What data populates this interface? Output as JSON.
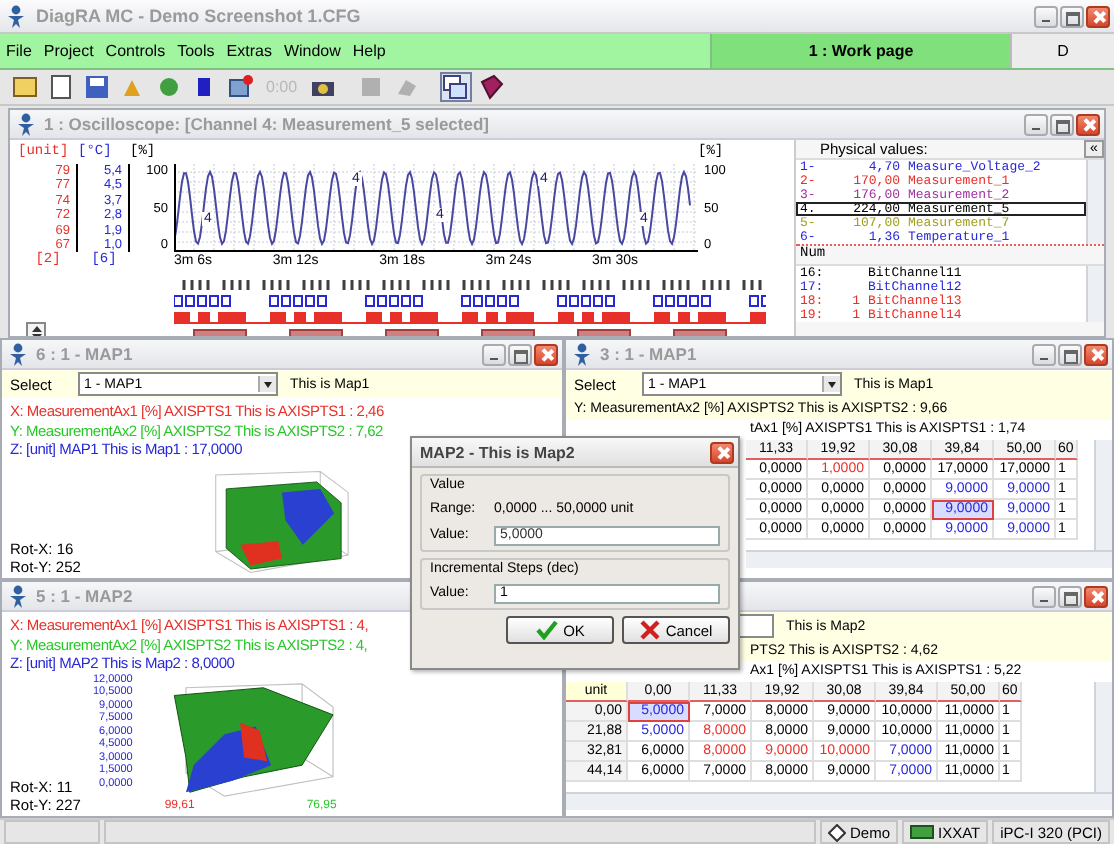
{
  "window": {
    "title": "DiagRA MC - Demo Screenshot 1.CFG"
  },
  "menu": [
    "File",
    "Project",
    "Controls",
    "Tools",
    "Extras",
    "Window",
    "Help"
  ],
  "work_page": {
    "label": "1 : Work page",
    "selected": true
  },
  "work_page_button": "D",
  "toolbar": {
    "timer": "0:00"
  },
  "oscilloscope": {
    "title": "1 : Oscilloscope: [Channel 4: Measurement_5 selected]",
    "axes": [
      {
        "header": "[unit]",
        "ticks": [
          "79",
          "77",
          "74",
          "72",
          "69",
          "67"
        ],
        "footer": "[2]",
        "color": "#e8302a"
      },
      {
        "header": "[°C]",
        "ticks": [
          "5,4",
          "4,5",
          "3,7",
          "2,8",
          "1,9",
          "1,0"
        ],
        "footer": "[6]",
        "color": "#2828d8"
      }
    ],
    "left_percent_axis": {
      "header": "[%]",
      "ticks": [
        "100",
        "50",
        "0"
      ]
    },
    "right_percent_axis": {
      "header": "[%]",
      "ticks": [
        "100",
        "50",
        "0"
      ]
    },
    "time_ticks": [
      "3m 6s",
      "3m 12s",
      "3m 18s",
      "3m 24s",
      "3m 30s"
    ],
    "markers": [
      "4",
      "4",
      "4",
      "4",
      "4"
    ],
    "physical_values": {
      "title": "Physical values:",
      "collapse": "«",
      "rows": [
        {
          "num": "1-",
          "value": "4,70",
          "name": "Measure_Voltage_2",
          "color": "#2828d8",
          "selected": false
        },
        {
          "num": "2-",
          "value": "170,00",
          "name": "Measurement_1",
          "color": "#e8302a",
          "selected": false
        },
        {
          "num": "3-",
          "value": "176,00",
          "name": "Measurement_2",
          "color": "#a030a0",
          "selected": false
        },
        {
          "num": "4.",
          "value": "224,00",
          "name": "Measurement_5",
          "color": "#000000",
          "selected": true
        },
        {
          "num": "5-",
          "value": "107,00",
          "name": "Measurement_7",
          "color": "#a0a020",
          "selected": false
        },
        {
          "num": "6-",
          "value": "1,36",
          "name": "Temperature_1",
          "color": "#2828d8",
          "selected": false
        }
      ]
    },
    "bit_channels": {
      "header": "Num",
      "rows": [
        {
          "num": "16:",
          "name": "BitChannel11",
          "color": "#000000"
        },
        {
          "num": "17:",
          "name": "BitChannel12",
          "color": "#2828d8"
        },
        {
          "num": "18:",
          "value": "1",
          "name": "BitChannel13",
          "color": "#e8302a"
        },
        {
          "num": "19:",
          "value": "1",
          "name": "BitChannel14",
          "color": "#e8302a"
        }
      ]
    }
  },
  "map1_plot": {
    "title": "6 : 1 - MAP1",
    "select_label": "Select",
    "select_value": "1 - MAP1",
    "description": "This is Map1",
    "axis_lines": [
      {
        "text": "X: MeasurementAx1 [%] AXISPTS1 This is AXISPTS1 : 2,46",
        "color": "#e8302a"
      },
      {
        "text": "Y: MeasurementAx2 [%] AXISPTS2 This is AXISPTS2 : 7,62",
        "color": "#28c828"
      },
      {
        "text": "Z: [unit] MAP1 This is Map1 : 17,0000",
        "color": "#2828d8"
      }
    ],
    "rot_x": "Rot-X: 16",
    "rot_y": "Rot-Y: 252"
  },
  "map1_table": {
    "title": "3 : 1 - MAP1",
    "select_label": "Select",
    "select_value": "1 - MAP1",
    "description": "This is Map1",
    "y_line": "Y: MeasurementAx2 [%] AXISPTS2 This is AXISPTS2 : 9,66",
    "x_line": "tAx1 [%] AXISPTS1 This is AXISPTS1 : 1,74",
    "columns": [
      "11,33",
      "19,92",
      "30,08",
      "39,84",
      "50,00",
      "60"
    ],
    "rows": [
      {
        "cells": [
          {
            "text": "0,0000",
            "color": "#000000",
            "selected": false
          },
          {
            "text": "1,0000",
            "color": "#e8302a",
            "selected": false
          },
          {
            "text": "0,0000",
            "color": "#000000",
            "selected": false
          },
          {
            "text": "17,0000",
            "color": "#000000",
            "selected": false
          },
          {
            "text": "17,0000",
            "color": "#000000",
            "selected": false
          },
          {
            "text": "1",
            "color": "#000000",
            "selected": false
          }
        ]
      },
      {
        "cells": [
          {
            "text": "0,0000",
            "color": "#000000",
            "selected": false
          },
          {
            "text": "0,0000",
            "color": "#000000",
            "selected": false
          },
          {
            "text": "0,0000",
            "color": "#000000",
            "selected": false
          },
          {
            "text": "9,0000",
            "color": "#2828d8",
            "selected": false
          },
          {
            "text": "9,0000",
            "color": "#2828d8",
            "selected": false
          },
          {
            "text": "1",
            "color": "#000000",
            "selected": false
          }
        ]
      },
      {
        "cells": [
          {
            "text": "0,0000",
            "color": "#000000",
            "selected": false
          },
          {
            "text": "0,0000",
            "color": "#000000",
            "selected": false
          },
          {
            "text": "0,0000",
            "color": "#000000",
            "selected": false
          },
          {
            "text": "9,0000",
            "color": "#2828d8",
            "selected": true
          },
          {
            "text": "9,0000",
            "color": "#2828d8",
            "selected": false
          },
          {
            "text": "1",
            "color": "#000000",
            "selected": false
          }
        ]
      },
      {
        "cells": [
          {
            "text": "0,0000",
            "color": "#000000",
            "selected": false
          },
          {
            "text": "0,0000",
            "color": "#000000",
            "selected": false
          },
          {
            "text": "0,0000",
            "color": "#000000",
            "selected": false
          },
          {
            "text": "9,0000",
            "color": "#2828d8",
            "selected": false
          },
          {
            "text": "9,0000",
            "color": "#2828d8",
            "selected": false
          },
          {
            "text": "1",
            "color": "#000000",
            "selected": false
          }
        ]
      }
    ]
  },
  "map2_plot": {
    "title": "5 : 1 - MAP2",
    "axis_lines": [
      {
        "text": "X: MeasurementAx1 [%] AXISPTS1 This is AXISPTS1 : 4,",
        "color": "#e8302a"
      },
      {
        "text": "Y: MeasurementAx2 [%] AXISPTS2 This is AXISPTS2 : 4,",
        "color": "#28c828"
      },
      {
        "text": "Z: [unit] MAP2 This is Map2 : 8,0000",
        "color": "#2828d8"
      }
    ],
    "z_ticks": [
      "12,0000",
      "10,5000",
      "9,0000",
      "7,5000",
      "6,0000",
      "4,5000",
      "3,0000",
      "1,5000",
      "0,0000"
    ],
    "x_tick": "99,61",
    "y_tick": "76,95",
    "rot_x": "Rot-X: 11",
    "rot_y": "Rot-Y: 227"
  },
  "map2_table": {
    "description": "This is Map2",
    "y_line": "PTS2 This is AXISPTS2 : 4,62",
    "x_line": "Ax1 [%] AXISPTS1 This is AXISPTS1 : 5,22",
    "corner": "unit",
    "columns": [
      "0,00",
      "11,33",
      "19,92",
      "30,08",
      "39,84",
      "50,00",
      "60"
    ],
    "rows": [
      {
        "header": "0,00",
        "cells": [
          {
            "text": "5,0000",
            "color": "#2828d8",
            "selected": true
          },
          {
            "text": "7,0000",
            "color": "#000000",
            "selected": false
          },
          {
            "text": "8,0000",
            "color": "#000000",
            "selected": false
          },
          {
            "text": "9,0000",
            "color": "#000000",
            "selected": false
          },
          {
            "text": "10,0000",
            "color": "#000000",
            "selected": false
          },
          {
            "text": "11,0000",
            "color": "#000000",
            "selected": false
          },
          {
            "text": "1",
            "color": "#000000",
            "selected": false
          }
        ]
      },
      {
        "header": "21,88",
        "cells": [
          {
            "text": "5,0000",
            "color": "#2828d8",
            "selected": false
          },
          {
            "text": "8,0000",
            "color": "#e8302a",
            "selected": false
          },
          {
            "text": "8,0000",
            "color": "#000000",
            "selected": false
          },
          {
            "text": "9,0000",
            "color": "#000000",
            "selected": false
          },
          {
            "text": "10,0000",
            "color": "#000000",
            "selected": false
          },
          {
            "text": "11,0000",
            "color": "#000000",
            "selected": false
          },
          {
            "text": "1",
            "color": "#000000",
            "selected": false
          }
        ]
      },
      {
        "header": "32,81",
        "cells": [
          {
            "text": "6,0000",
            "color": "#000000",
            "selected": false
          },
          {
            "text": "8,0000",
            "color": "#e8302a",
            "selected": false
          },
          {
            "text": "9,0000",
            "color": "#e8302a",
            "selected": false
          },
          {
            "text": "10,0000",
            "color": "#e8302a",
            "selected": false
          },
          {
            "text": "7,0000",
            "color": "#2828d8",
            "selected": false
          },
          {
            "text": "11,0000",
            "color": "#000000",
            "selected": false
          },
          {
            "text": "1",
            "color": "#000000",
            "selected": false
          }
        ]
      },
      {
        "header": "44,14",
        "cells": [
          {
            "text": "6,0000",
            "color": "#000000",
            "selected": false
          },
          {
            "text": "7,0000",
            "color": "#000000",
            "selected": false
          },
          {
            "text": "8,0000",
            "color": "#000000",
            "selected": false
          },
          {
            "text": "9,0000",
            "color": "#000000",
            "selected": false
          },
          {
            "text": "7,0000",
            "color": "#2828d8",
            "selected": false
          },
          {
            "text": "11,0000",
            "color": "#000000",
            "selected": false
          },
          {
            "text": "1",
            "color": "#000000",
            "selected": false
          }
        ]
      }
    ]
  },
  "dialog": {
    "title": "MAP2 - This is Map2",
    "value_group": "Value",
    "range_label": "Range:",
    "range": "0,0000 ... 50,0000 unit",
    "value_label": "Value:",
    "value": "5,0000",
    "steps_group": "Incremental Steps (dec)",
    "steps_label": "Value:",
    "steps_value": "1",
    "ok": "OK",
    "cancel": "Cancel"
  },
  "status_bar": {
    "mode": "Demo",
    "interface": "IXXAT",
    "device": "iPC-I 320 (PCI)"
  }
}
